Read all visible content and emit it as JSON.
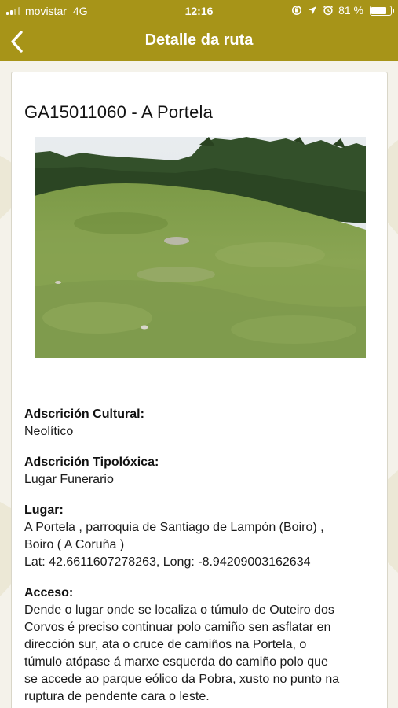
{
  "status": {
    "carrier": "movistar",
    "network": "4G",
    "time": "12:16",
    "battery": "81 %",
    "battery_level": 0.81
  },
  "header": {
    "title": "Detalle da ruta",
    "back_icon": "chevron-left-icon"
  },
  "colors": {
    "header_bg": "#a79418",
    "page_bg": "#f4f2ea"
  },
  "detail": {
    "title": "GA15011060 - A Portela",
    "cultural_label": "Adscrición Cultural:",
    "cultural_value": "Neolítico",
    "typology_label": "Adscrición Tipolóxica:",
    "typology_value": "Lugar Funerario",
    "place_label": "Lugar:",
    "place_line1": "A Portela , parroquia de Santiago de Lampón (Boiro) ,",
    "place_line2": "Boiro ( A Coruña )",
    "place_line3": "Lat: 42.6611607278263, Long: -8.94209003162634",
    "access_label": "Acceso:",
    "access_lines": [
      "Dende o lugar onde se localiza o túmulo de Outeiro dos",
      "Corvos é preciso continuar polo camiño sen asflatar en",
      "dirección sur, ata o cruce de camiños na Portela, o",
      "túmulo atópase á marxe esquerda do camiño polo que",
      "se accede ao parque eólico da Pobra, xusto no punto na",
      "ruptura de pendente cara o leste."
    ]
  }
}
